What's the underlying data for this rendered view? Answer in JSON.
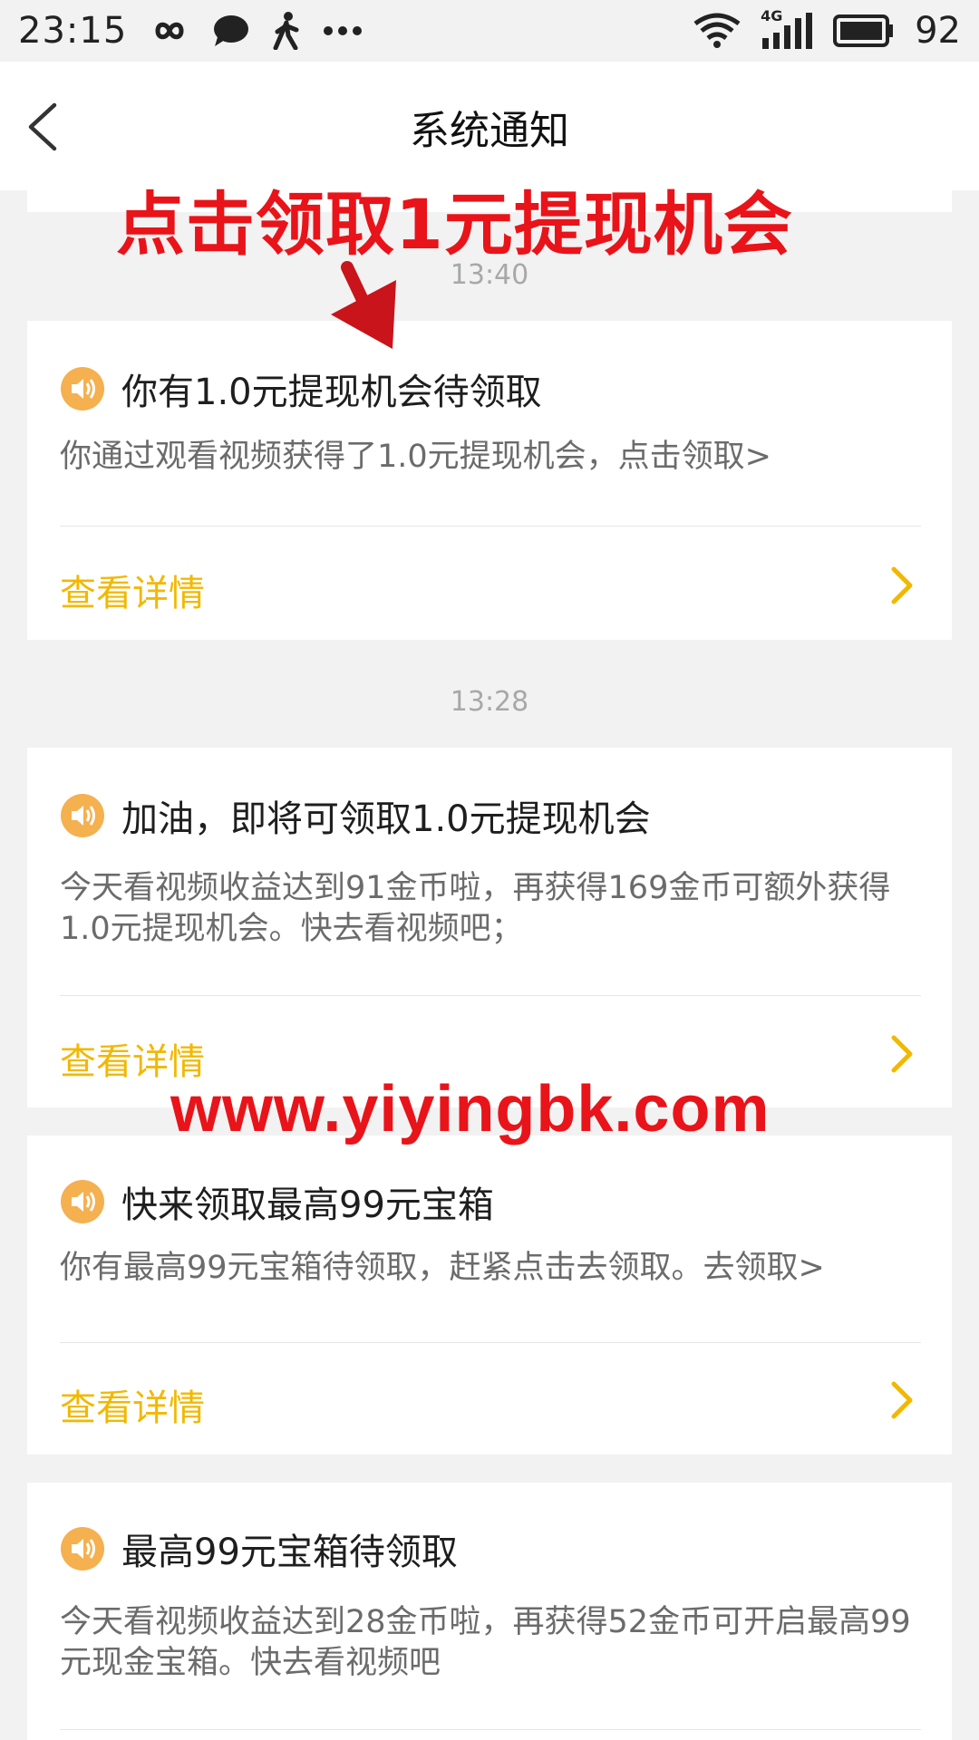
{
  "status_bar": {
    "time": "23:15",
    "battery_level": "92",
    "network_label": "4G",
    "icons": [
      "infinity-icon",
      "chat-bubble-icon",
      "walking-person-icon",
      "more-dots-icon",
      "wifi-icon",
      "signal-icon",
      "battery-icon"
    ]
  },
  "nav": {
    "title": "系统通知",
    "back_icon": "back-arrow-icon"
  },
  "overlay": {
    "promo_text": "点击领取1元提现机会",
    "watermark": "www.yiyingbk.com",
    "colors": {
      "promo": "#e8141a"
    }
  },
  "colors": {
    "link": "#f2b800",
    "speaker_icon": "#f5b04f",
    "body_text": "#6b6b6b",
    "timestamp": "#a8a8a8"
  },
  "notifications": [
    {
      "time": "13:40",
      "title": "你有1.0元提现机会待领取",
      "body": "你通过观看视频获得了1.0元提现机会，点击领取>",
      "link": "查看详情"
    },
    {
      "time": "13:28",
      "title": "加油，即将可领取1.0元提现机会",
      "body": "今天看视频收益达到91金币啦，再获得169金币可额外获得1.0元提现机会。快去看视频吧；",
      "link": "查看详情"
    },
    {
      "time": "",
      "title": "快来领取最高99元宝箱",
      "body": "你有最高99元宝箱待领取，赶紧点击去领取。去领取>",
      "link": "查看详情"
    },
    {
      "time": "",
      "title": "最高99元宝箱待领取",
      "body": "今天看视频收益达到28金币啦，再获得52金币可开启最高99元现金宝箱。快去看视频吧",
      "link": ""
    }
  ]
}
